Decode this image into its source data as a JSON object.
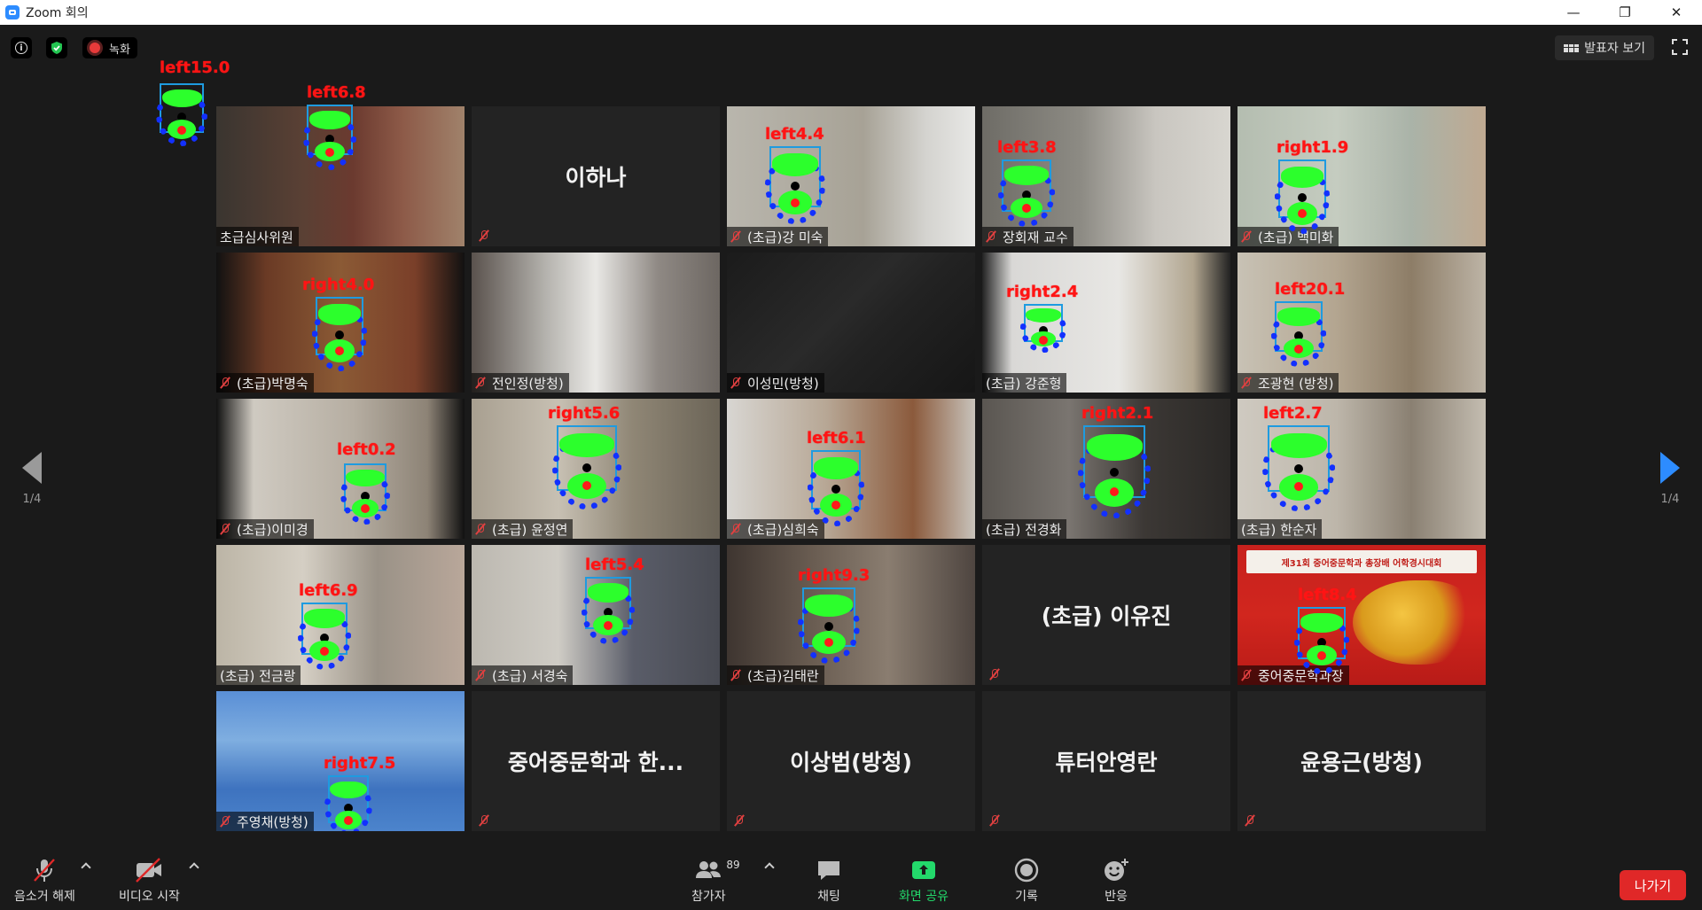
{
  "window": {
    "title": "Zoom 회의",
    "minimize": "—",
    "restore": "❐",
    "close": "✕"
  },
  "topbar": {
    "info": "i",
    "record_label": "녹화",
    "speaker_view_label": "발표자 보기"
  },
  "nav": {
    "left_page": "1/4",
    "right_page": "1/4"
  },
  "tiles": [
    {
      "name": "초급심사위원",
      "type": "video",
      "muted": false,
      "bg": "linear-gradient(90deg,#3a3530 0%,#5a4034 35%,#6b3a2f 55%,#8d5a48 75%,#a0826b 100%)"
    },
    {
      "name": "이하나",
      "type": "name",
      "muted": true
    },
    {
      "name": "(초급)강 미숙",
      "type": "video",
      "muted": true,
      "bg": "linear-gradient(90deg,#b9b6ad 0%,#a7a296 55%,#d4d3cf 80%,#e8e8e6 100%)"
    },
    {
      "name": "장회재 교수",
      "type": "video",
      "muted": true,
      "bg": "linear-gradient(90deg,#6e6c66 0%,#8d8b84 40%,#c9c6c0 70%,#d8d6d0 100%)"
    },
    {
      "name": "(초급) 백미화",
      "type": "video",
      "muted": true,
      "bg": "linear-gradient(90deg,#b4bdb0 0%,#c5ccc0 40%,#aab3a8 70%,#bfa991 100%)"
    },
    {
      "name": "(초급)박명숙",
      "type": "video",
      "muted": true,
      "bg": "linear-gradient(90deg,#111 0%,#6a3a25 20%,#8b5a35 50%,#7a3f29 80%,#111 100%)"
    },
    {
      "name": "전인정(방청)",
      "type": "video",
      "muted": true,
      "bg": "linear-gradient(90deg,#5a524d 0%,#b5b3ae 30%,#e9e8e5 50%,#8f8984 75%,#6d6762 100%)"
    },
    {
      "name": "이성민(방청)",
      "type": "video",
      "muted": true,
      "bg": "linear-gradient(135deg,#1b1b1b 0%,#2a2a2a 45%,#222 60%,#161616 100%)"
    },
    {
      "name": "(초급) 강준형",
      "type": "video",
      "muted": false,
      "bg": "linear-gradient(90deg,#222 0%,#d9d8d6 12%,#e8e7e4 55%,#b1a58f 85%,#222 100%)"
    },
    {
      "name": "조광현 (방청)",
      "type": "video",
      "muted": true,
      "bg": "linear-gradient(90deg,#c8c2b5 0%,#b3a590 40%,#8d7d67 70%,#bdb4a6 100%)"
    },
    {
      "name": "(초급)이미경",
      "type": "video",
      "muted": true,
      "bg": "linear-gradient(90deg,#111 0%,#cfcac1 15%,#b6aea2 55%,#8d8376 85%,#111 100%)"
    },
    {
      "name": "(초급) 윤정연",
      "type": "video",
      "muted": true,
      "bg": "linear-gradient(90deg,#a89f90 0%,#c7c0b3 35%,#8f8675 65%,#6b6457 100%)"
    },
    {
      "name": "(초급)심희숙",
      "type": "video",
      "muted": true,
      "bg": "linear-gradient(90deg,#d8d6d2 0%,#b7a795 40%,#8b5a3c 75%,#c8c3bb 100%)"
    },
    {
      "name": "(초급) 전경화",
      "type": "video",
      "muted": false,
      "active": true,
      "bg": "linear-gradient(90deg,#5a5651 0%,#7a7570 35%,#3c3835 65%,#2a2826 100%)"
    },
    {
      "name": "(초급) 한순자",
      "type": "video",
      "muted": false,
      "bg": "linear-gradient(90deg,#cfcac1 0%,#bdb6aa 40%,#8a8072 70%,#c4bdb1 100%)"
    },
    {
      "name": "(초급) 전금랑",
      "type": "video",
      "muted": false,
      "bg": "linear-gradient(90deg,#bcb5a6 0%,#d5cfc4 35%,#9a9287 65%,#b9a79a 100%)"
    },
    {
      "name": "(초급) 서경숙",
      "type": "video",
      "muted": true,
      "bg": "linear-gradient(90deg,#bcb8b0 0%,#cfccc5 35%,#5a5d69 65%,#484a52 100%)"
    },
    {
      "name": "(초급)김태란",
      "type": "video",
      "muted": true,
      "bg": "linear-gradient(90deg,#3e3530 0%,#6a5d52 35%,#8a7d70 65%,#4e4540 100%)"
    },
    {
      "name": "(초급) 이유진",
      "type": "name",
      "muted": true
    },
    {
      "name": "중어중문학과장",
      "type": "video",
      "muted": true,
      "bg": "linear-gradient(180deg,#c7211d 0%,#d1261e 50%,#b81b17 100%)"
    },
    {
      "name": "주영채(방청)",
      "type": "video",
      "muted": true,
      "bg": "linear-gradient(180deg,#5a8fd6 0%,#7faee0 35%,#3e73bf 70%,#4c84cc 100%)"
    },
    {
      "name": "중어중문학과 한...",
      "type": "name",
      "muted": true
    },
    {
      "name": "이상범(방청)",
      "type": "name",
      "muted": true
    },
    {
      "name": "튜터안영란",
      "type": "name",
      "muted": true
    },
    {
      "name": "윤용근(방청)",
      "type": "name",
      "muted": true
    }
  ],
  "face_labels": [
    "left15.0",
    "left6.8",
    "left4.4",
    "left3.8",
    "right1.9",
    "right4.0",
    "right2.4",
    "left20.1",
    "left0.2",
    "right5.6",
    "left6.1",
    "right2.1",
    "left2.7",
    "left6.9",
    "left5.4",
    "right9.3",
    "left8.4",
    "right7.5"
  ],
  "banner_text": "제31회 중어중문학과 총장배 어학경시대회",
  "toolbar": {
    "mute_label": "음소거 해제",
    "video_label": "비디오 시작",
    "participants_label": "참가자",
    "participants_count": "89",
    "chat_label": "채팅",
    "share_label": "화면 공유",
    "record_label": "기록",
    "reactions_label": "반응",
    "leave_label": "나가기"
  },
  "colors": {
    "accent": "#2d8cff",
    "share": "#23d96b",
    "leave": "#e02828",
    "active_border": "#d5e56b"
  }
}
